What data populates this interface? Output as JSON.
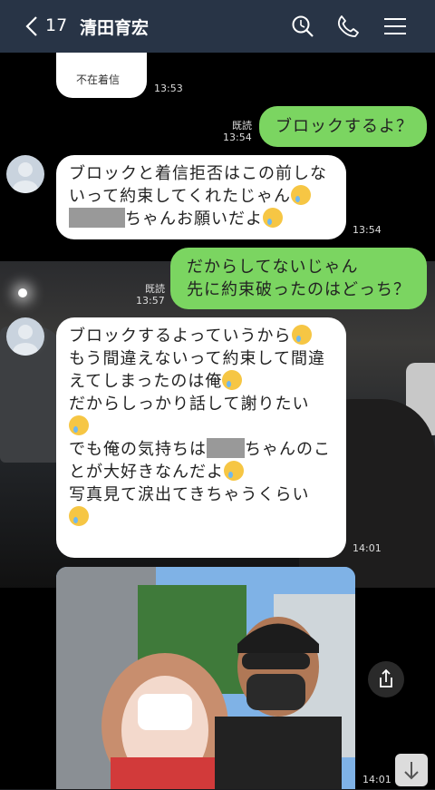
{
  "header": {
    "unread_count": "17",
    "contact_name": "清田育宏",
    "icons": [
      "back-chevron-icon",
      "search-icon",
      "phone-icon",
      "menu-icon"
    ]
  },
  "messages": {
    "missed_call_label": "不在着信",
    "missed_call_time": "13:53",
    "m1_read": "既読",
    "m1_time": "13:54",
    "m1_text": "ブロックするよ？",
    "m2_line1": "ブロックと着信拒否はこの前しな",
    "m2_line2": "いって約束してくれたじゃん",
    "m2_line3": "ちゃんお願いだよ",
    "m2_time": "13:54",
    "m3_read": "既読",
    "m3_time": "13:57",
    "m3_line1": "だからしてないじゃん",
    "m3_line2": "先に約束破ったのはどっち？",
    "m4_line1": "ブロックするよっていうから",
    "m4_line2": "もう間違えないって約束して間違",
    "m4_line3": "えてしまったのは俺",
    "m4_line4": "だからしっかり話して謝りたい",
    "m4_line6a": "でも俺の気持ちは",
    "m4_line6b": "ちゃんのこ",
    "m4_line7": "とが大好きなんだよ",
    "m4_line8": "写真見て涙出てきちゃうくらい",
    "m4_time": "14:01",
    "photo_time": "14:01"
  },
  "colors": {
    "header_bg": "#283446",
    "sent_bubble": "#7bd561",
    "received_bubble": "#ffffff"
  }
}
